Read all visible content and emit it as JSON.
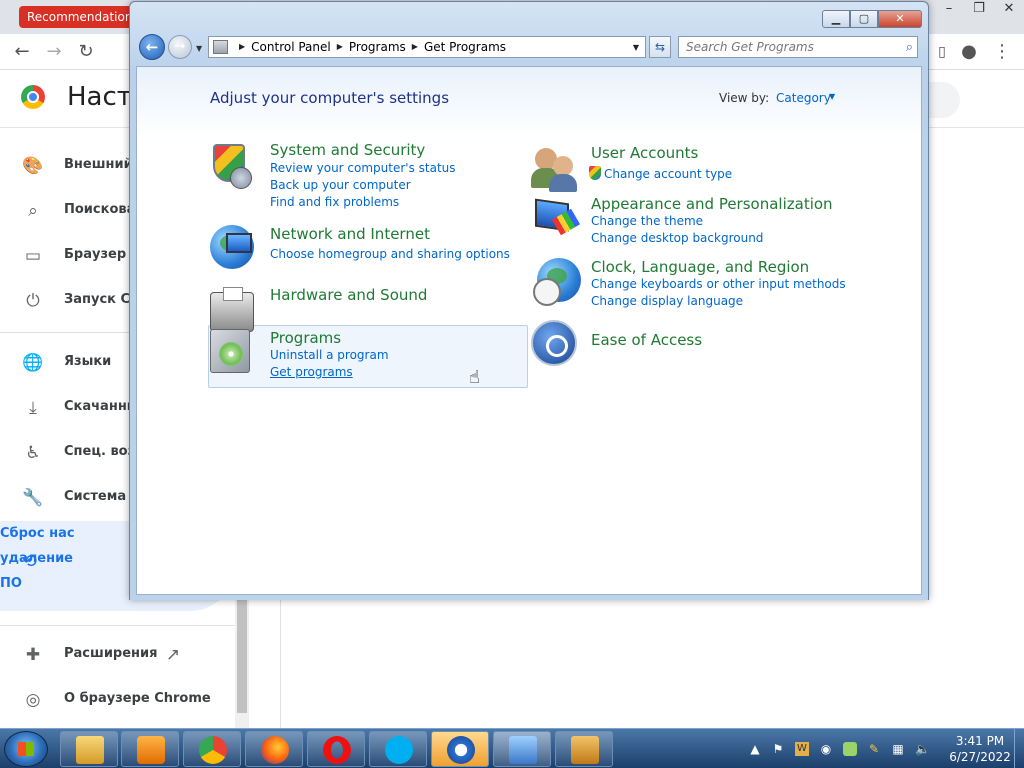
{
  "chrome": {
    "tab_label": "Recommendations",
    "settings_title": "Наст",
    "window_controls": [
      "–",
      "❐",
      "✕"
    ],
    "sidebar": {
      "items": [
        {
          "icon": "palette-icon",
          "glyph": "🎨",
          "label": "Внешний"
        },
        {
          "icon": "search-icon",
          "glyph": "⌕",
          "label": "Поискова"
        },
        {
          "icon": "browser-icon",
          "glyph": "▭",
          "label": "Браузер п"
        },
        {
          "icon": "power-icon",
          "glyph": "⏻",
          "label": "Запуск Ch"
        },
        {
          "icon": "globe-icon",
          "glyph": "🌐",
          "label": "Языки"
        },
        {
          "icon": "download-icon",
          "glyph": "⤓",
          "label": "Скачанны"
        },
        {
          "icon": "accessibility-icon",
          "glyph": "♿",
          "label": "Спец. воз"
        },
        {
          "icon": "wrench-icon",
          "glyph": "🔧",
          "label": "Система"
        },
        {
          "icon": "extension-icon",
          "glyph": "✚",
          "label": "Расширения"
        },
        {
          "icon": "chrome-icon",
          "glyph": "◎",
          "label": "О браузере Chrome"
        }
      ],
      "active": {
        "icon": "restore-icon",
        "glyph": "⟲",
        "label": "Сброс нас\nудаление\nПО"
      },
      "external_glyph": "↗"
    }
  },
  "control_panel": {
    "address": {
      "crumbs": [
        "Control Panel",
        "Programs",
        "Get Programs"
      ]
    },
    "search_placeholder": "Search Get Programs",
    "heading": "Adjust your computer's settings",
    "view_by_label": "View by:",
    "view_by_value": "Category",
    "categories": {
      "system_security": {
        "title": "System and Security",
        "links": [
          "Review your computer's status",
          "Back up your computer",
          "Find and fix problems"
        ]
      },
      "network": {
        "title": "Network and Internet",
        "links": [
          "Choose homegroup and sharing options"
        ]
      },
      "hardware": {
        "title": "Hardware and Sound",
        "links": []
      },
      "programs": {
        "title": "Programs",
        "links": [
          "Uninstall a program",
          "Get programs"
        ]
      },
      "user_accounts": {
        "title": "User Accounts",
        "links": [
          "Change account type"
        ]
      },
      "appearance": {
        "title": "Appearance and Personalization",
        "links": [
          "Change the theme",
          "Change desktop background"
        ]
      },
      "clock": {
        "title": "Clock, Language, and Region",
        "links": [
          "Change keyboards or other input methods",
          "Change display language"
        ]
      },
      "ease": {
        "title": "Ease of Access",
        "links": []
      }
    }
  },
  "taskbar": {
    "time": "3:41 PM",
    "date": "6/27/2022",
    "apps": [
      "explorer-icon",
      "media-player-icon",
      "chrome-icon",
      "firefox-icon",
      "opera-icon",
      "skype-icon",
      "quicktime-icon",
      "control-panel-icon",
      "word-icon"
    ]
  },
  "colors": {
    "link": "#0066cc",
    "category_title": "#1f7a33",
    "heading": "#1e3287",
    "chrome_accent": "#1a73e8",
    "chrome_tab": "#d93025"
  }
}
